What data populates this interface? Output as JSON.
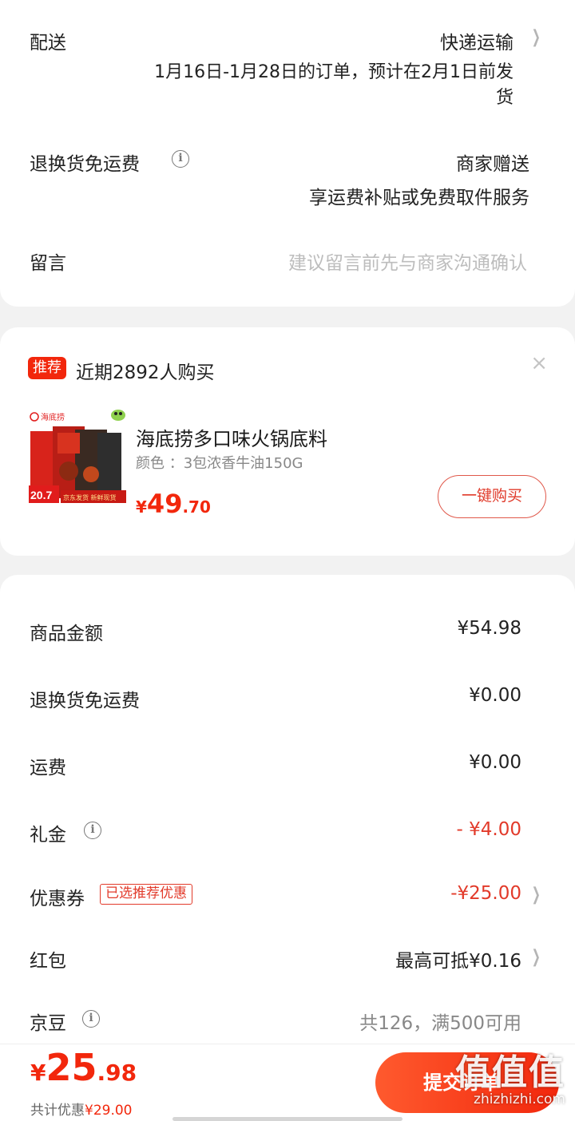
{
  "delivery": {
    "label": "配送",
    "method": "快递运输",
    "note_line1": "1月16日-1月28日的订单，预计在2月1日前发",
    "note_line2": "货"
  },
  "return_insurance": {
    "label": "退换货免运费",
    "value": "商家赠送",
    "sub": "享运费补贴或免费取件服务"
  },
  "message": {
    "label": "留言",
    "placeholder": "建议留言前先与商家沟通确认"
  },
  "recommend": {
    "badge": "推荐",
    "title": "近期2892人购买",
    "close_icon": "×",
    "product": {
      "name": "海底捞多口味火锅底料",
      "spec": "颜色 ：3包浓香牛油150G",
      "price_symbol": "¥",
      "price_int": "49",
      "price_dec": ".70",
      "image_price": "20.7",
      "image_brand": "海底捞",
      "image_caption": "京东发货 新鲜现货"
    },
    "buy_label": "一键购买"
  },
  "summary": {
    "rows": [
      {
        "label": "商品金额",
        "value": "¥54.98"
      },
      {
        "label": "退换货免运费",
        "value": "¥0.00"
      },
      {
        "label": "运费",
        "value": "¥0.00"
      },
      {
        "label": "礼金",
        "value": "- ¥4.00"
      },
      {
        "label": "优惠券",
        "tag": "已选推荐优惠",
        "value": "-¥25.00"
      },
      {
        "label": "红包",
        "value": "最高可抵¥0.16"
      },
      {
        "label": "京豆",
        "value": "共126，满500可用"
      }
    ]
  },
  "footer": {
    "price_symbol": "¥",
    "price_int": "25",
    "price_dec": ".98",
    "discount_label": "共计优惠",
    "discount_amount": "¥29.00",
    "submit_label": "提交订单"
  },
  "watermark": {
    "brand": "值值值",
    "url": "zhizhizhi.com"
  },
  "colors": {
    "accent": "#f2270c",
    "muted": "#b5b5b5"
  }
}
